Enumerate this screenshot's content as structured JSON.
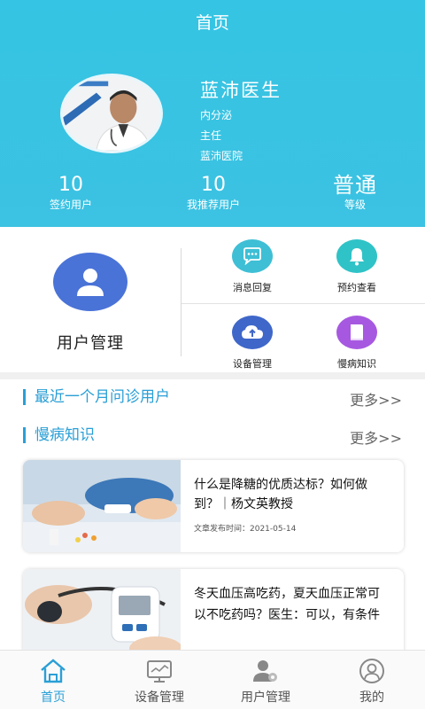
{
  "header": {
    "title": "首页",
    "doctor": {
      "name": "蓝沛医生",
      "department": "内分泌",
      "position": "主任",
      "hospital": "蓝沛医院"
    },
    "stats": [
      {
        "value": "10",
        "label": "签约用户"
      },
      {
        "value": "10",
        "label": "我推荐用户"
      },
      {
        "value": "普通",
        "label": "等级"
      }
    ]
  },
  "grid": {
    "user_management": "用户管理",
    "items": [
      {
        "label": "消息回复",
        "icon": "chat-icon",
        "color": "#3ebfd5"
      },
      {
        "label": "预约查看",
        "icon": "bell-icon",
        "color": "#2fc3c7"
      },
      {
        "label": "设备管理",
        "icon": "cloud-upload-icon",
        "color": "#3f67c9"
      },
      {
        "label": "慢病知识",
        "icon": "book-icon",
        "color": "#a659e0"
      }
    ]
  },
  "sections": {
    "recent": {
      "title": "最近一个月问诊用户",
      "more": "更多>>"
    },
    "knowledge": {
      "title": "慢病知识",
      "more": "更多>>"
    }
  },
  "articles": [
    {
      "title": "什么是降糖的优质达标？如何做到？｜杨文英教授",
      "meta": "文章发布时间：2021-05-14"
    },
    {
      "title": "冬天血压高吃药，夏天血压正常可以不吃药吗？医生：可以，有条件",
      "meta": ""
    }
  ],
  "tabbar": [
    {
      "label": "首页",
      "icon": "home-icon",
      "active": true
    },
    {
      "label": "设备管理",
      "icon": "monitor-icon",
      "active": false
    },
    {
      "label": "用户管理",
      "icon": "users-icon",
      "active": false
    },
    {
      "label": "我的",
      "icon": "profile-icon",
      "active": false
    }
  ],
  "colors": {
    "header_bg": "#35c4e3",
    "accent": "#2a9fd6",
    "user_circle": "#4a73d7"
  }
}
